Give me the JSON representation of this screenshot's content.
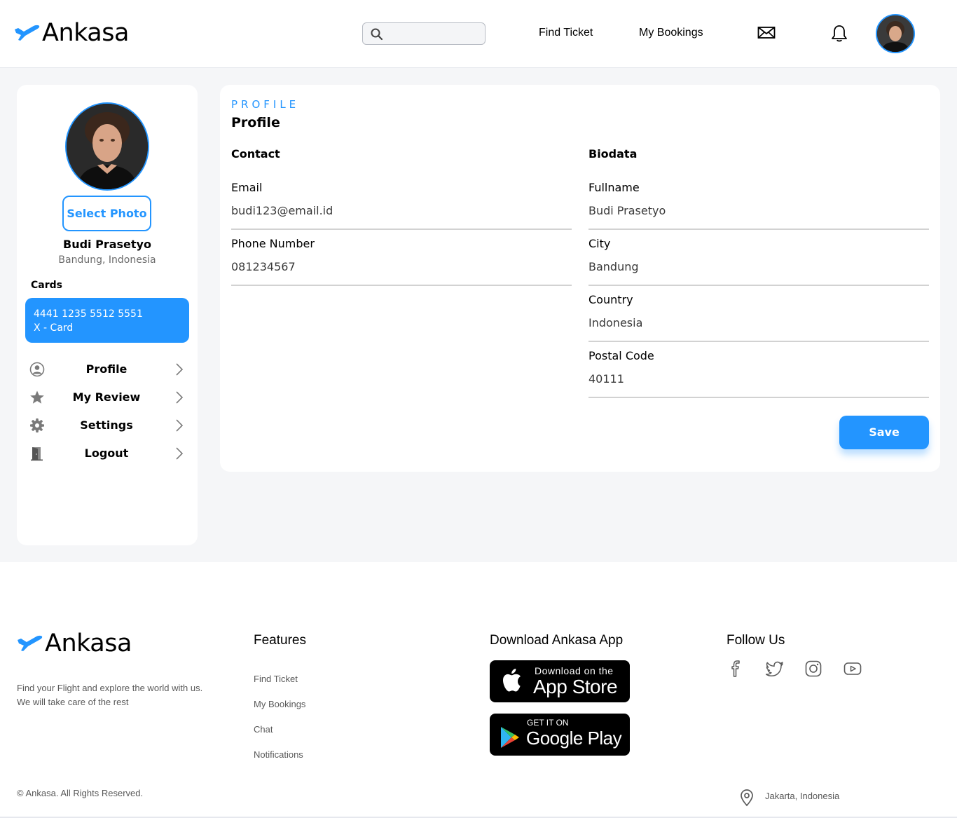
{
  "brand": {
    "name": "Ankasa",
    "accent_color": "#2395ff"
  },
  "header": {
    "search": {
      "placeholder": "",
      "value": ""
    },
    "nav": {
      "find_ticket": "Find Ticket",
      "my_bookings": "My Bookings"
    },
    "icons": [
      "search-icon",
      "mail-icon",
      "bell-icon",
      "avatar"
    ]
  },
  "sidebar": {
    "select_photo": "Select Photo",
    "user_name": "Budi Prasetyo",
    "user_location": "Bandung, Indonesia",
    "cards_label": "Cards",
    "card": {
      "number": "4441 1235 5512 5551",
      "type": "X - Card"
    },
    "menu": [
      {
        "label": "Profile",
        "icon": "user-circle-icon"
      },
      {
        "label": "My Review",
        "icon": "star-icon"
      },
      {
        "label": "Settings",
        "icon": "gear-icon"
      },
      {
        "label": "Logout",
        "icon": "door-icon"
      }
    ]
  },
  "profile": {
    "eyebrow": "PROFILE",
    "title": "Profile",
    "contact": {
      "heading": "Contact",
      "email_label": "Email",
      "email_value": "budi123@email.id",
      "phone_label": "Phone Number",
      "phone_value": "081234567"
    },
    "biodata": {
      "heading": "Biodata",
      "fullname_label": "Fullname",
      "fullname_value": "Budi Prasetyo",
      "city_label": "City",
      "city_value": "Bandung",
      "country_label": "Country",
      "country_value": "Indonesia",
      "postal_label": "Postal Code",
      "postal_value": "40111"
    },
    "save_label": "Save"
  },
  "footer": {
    "tagline_line1": "Find your Flight and explore the world with us.",
    "tagline_line2": "We will take care of the rest",
    "features_heading": "Features",
    "features": [
      "Find Ticket",
      "My Bookings",
      "Chat",
      "Notifications"
    ],
    "download_heading": "Download Ankasa App",
    "appstore_small": "Download on the",
    "appstore_big": "App Store",
    "googleplay_small": "GET IT ON",
    "googleplay_big": "Google Play",
    "follow_heading": "Follow Us",
    "social_icons": [
      "facebook-icon",
      "twitter-icon",
      "instagram-icon",
      "youtube-icon"
    ],
    "copyright": "© Ankasa. All Rights Reserved.",
    "location": "Jakarta, Indonesia"
  }
}
